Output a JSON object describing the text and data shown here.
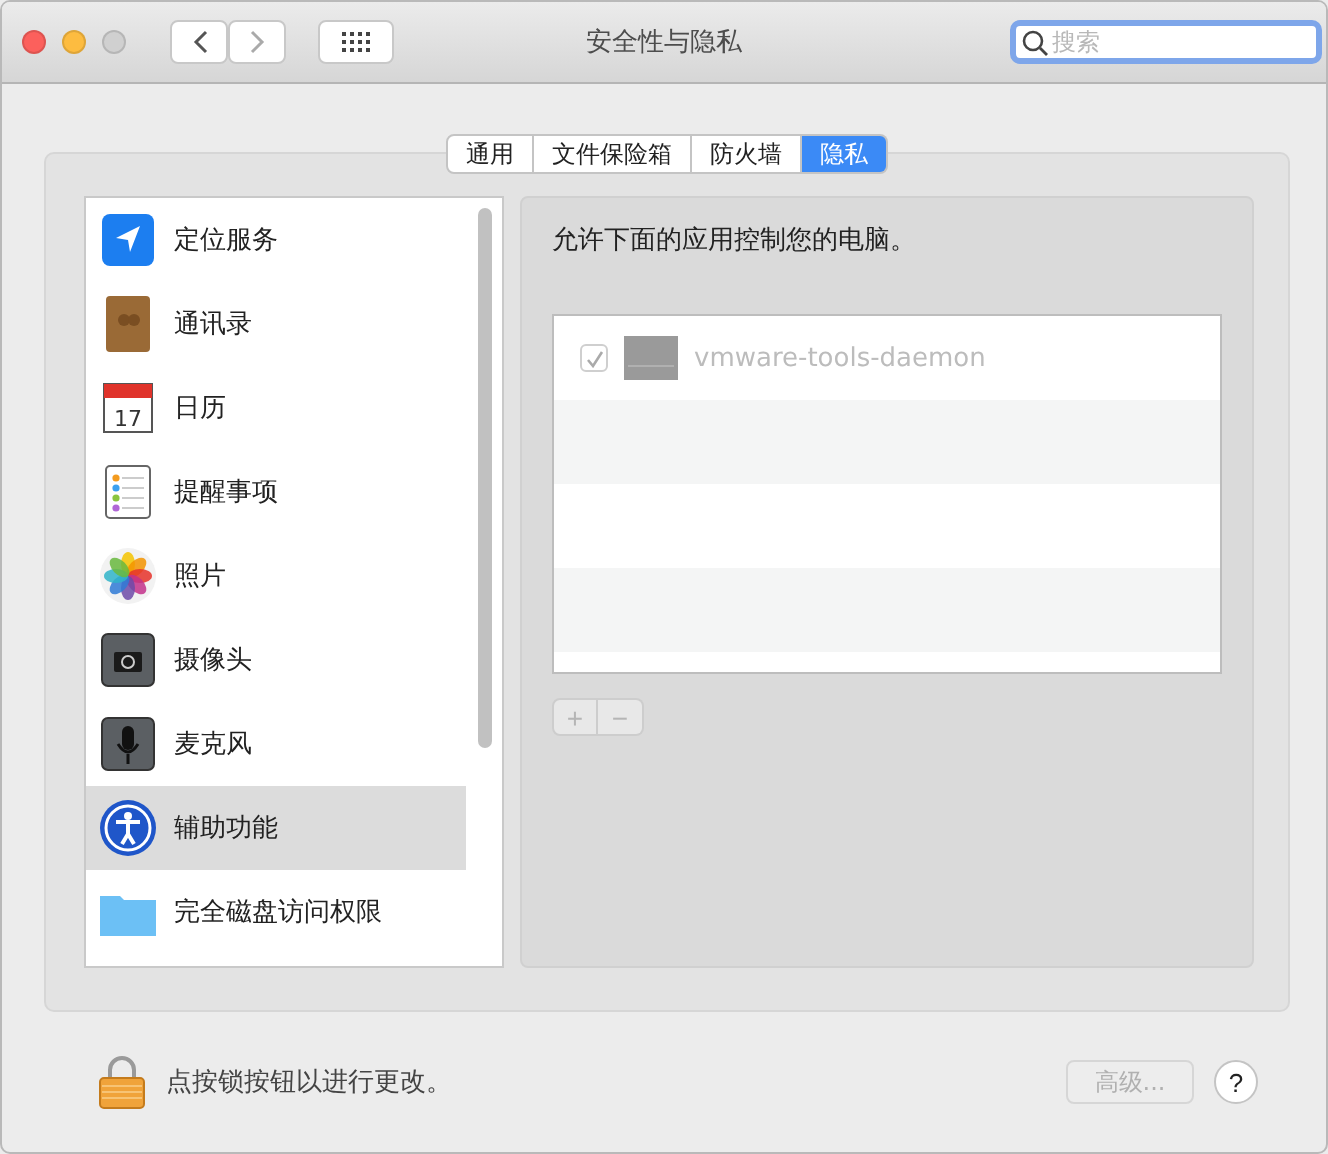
{
  "window": {
    "title": "安全性与隐私"
  },
  "search": {
    "placeholder": "搜索",
    "focused": true
  },
  "tabs": [
    {
      "label": "通用",
      "selected": false
    },
    {
      "label": "文件保险箱",
      "selected": false
    },
    {
      "label": "防火墙",
      "selected": false
    },
    {
      "label": "隐私",
      "selected": true
    }
  ],
  "sidebar": {
    "items": [
      {
        "label": "定位服务",
        "kind": "location",
        "selected": false
      },
      {
        "label": "通讯录",
        "kind": "contacts",
        "selected": false
      },
      {
        "label": "日历",
        "kind": "calendar",
        "day": "17",
        "selected": false
      },
      {
        "label": "提醒事项",
        "kind": "reminders",
        "selected": false
      },
      {
        "label": "照片",
        "kind": "photos",
        "selected": false
      },
      {
        "label": "摄像头",
        "kind": "camera",
        "selected": false
      },
      {
        "label": "麦克风",
        "kind": "microphone",
        "selected": false
      },
      {
        "label": "辅助功能",
        "kind": "accessibility",
        "selected": true
      },
      {
        "label": "完全磁盘访问权限",
        "kind": "folder",
        "selected": false
      }
    ]
  },
  "panel": {
    "description": "允许下面的应用控制您的电脑。",
    "apps": [
      {
        "name": "vmware-tools-daemon",
        "checked": true,
        "disabled": true
      }
    ],
    "add_label": "+",
    "remove_label": "−",
    "buttons_disabled": true
  },
  "footer": {
    "lock_text": "点按锁按钮以进行更改。",
    "advanced_label": "高级...",
    "advanced_disabled": true,
    "help_label": "?"
  }
}
